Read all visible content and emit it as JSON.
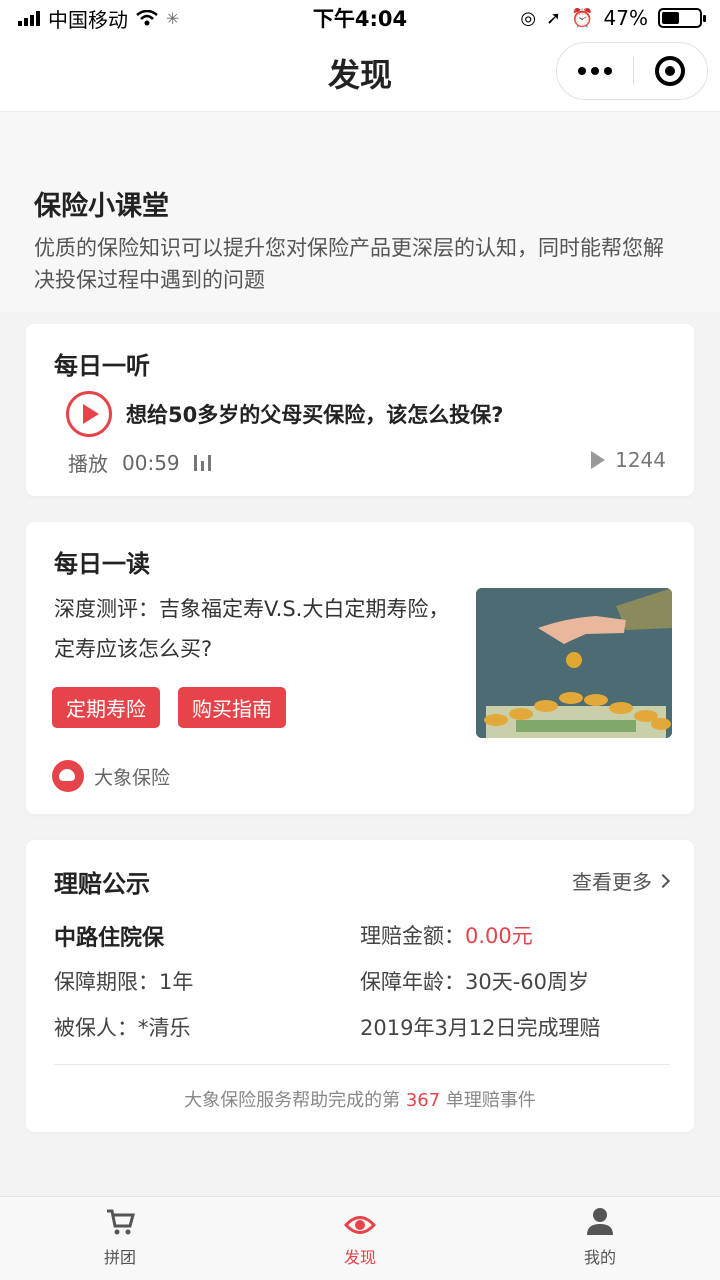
{
  "status_bar": {
    "carrier": "中国移动",
    "time": "下午4:04",
    "battery": "47%",
    "battery_level": 0.47
  },
  "nav": {
    "title": "发现"
  },
  "intro": {
    "title": "保险小课堂",
    "description": "优质的保险知识可以提升您对保险产品更深层的认知，同时能帮您解决投保过程中遇到的问题"
  },
  "daily_listen": {
    "title": "每日一听",
    "question": "想给50多岁的父母买保险，该怎么投保?",
    "play_label": "播放",
    "duration": "00:59",
    "play_count": "1244"
  },
  "daily_read": {
    "title": "每日一读",
    "text": "深度测评：吉象福定寿V.S.大白定期寿险，定寿应该怎么买?",
    "tags": [
      "定期寿险",
      "购买指南"
    ],
    "source": "大象保险"
  },
  "claims": {
    "title": "理赔公示",
    "more": "查看更多",
    "product": "中路住院保",
    "amount_label": "理赔金额：",
    "amount_value": "0.00元",
    "term_label": "保障期限：",
    "term_value": "1年",
    "age_label": "保障年龄：",
    "age_value": "30天-60周岁",
    "insured_label": "被保人：",
    "insured_value": "*清乐",
    "completed": "2019年3月12日完成理赔",
    "footer_prefix": "大象保险服务帮助完成的第 ",
    "footer_count": "367",
    "footer_suffix": " 单理赔事件"
  },
  "tabs": [
    {
      "label": "拼团",
      "icon": "cart-icon",
      "active": false
    },
    {
      "label": "发现",
      "icon": "eye-icon",
      "active": true
    },
    {
      "label": "我的",
      "icon": "user-icon",
      "active": false
    }
  ],
  "colors": {
    "accent": "#e6444a"
  }
}
